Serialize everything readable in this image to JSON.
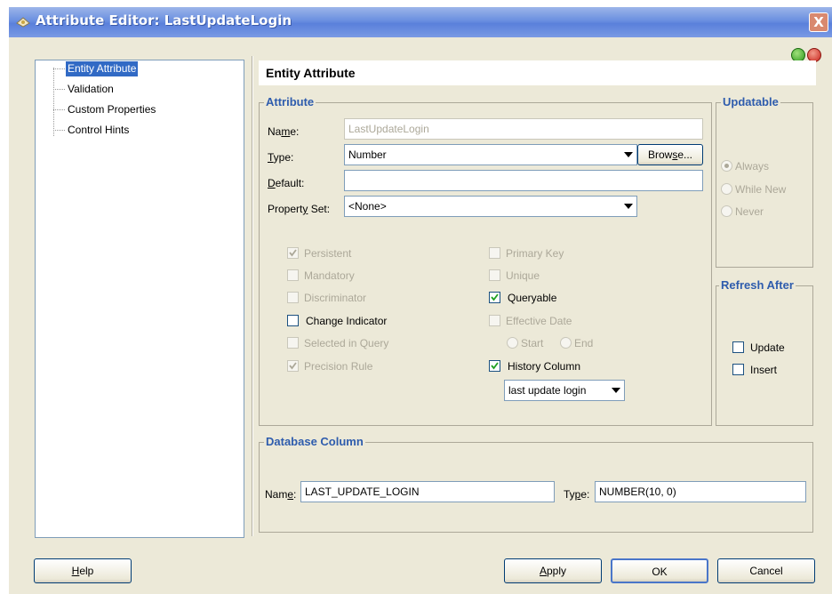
{
  "window": {
    "title": "Attribute Editor: LastUpdateLogin",
    "close_label": "X"
  },
  "tree": {
    "items": [
      {
        "label": "Entity Attribute",
        "selected": true
      },
      {
        "label": "Validation"
      },
      {
        "label": "Custom Properties"
      },
      {
        "label": "Control Hints"
      }
    ]
  },
  "panel": {
    "title": "Entity Attribute"
  },
  "attribute": {
    "group_title": "Attribute",
    "name_label": "Name:",
    "name_value": "LastUpdateLogin",
    "type_label": "Type:",
    "type_value": "Number",
    "browse_label": "Browse...",
    "default_label": "Default:",
    "default_value": "",
    "property_set_label": "Property Set:",
    "property_set_value": "<None>",
    "left_checks": [
      {
        "label": "Persistent",
        "checked": true,
        "enabled": false
      },
      {
        "label": "Mandatory",
        "checked": false,
        "enabled": false
      },
      {
        "label": "Discriminator",
        "checked": false,
        "enabled": false
      },
      {
        "label": "Change Indicator",
        "checked": false,
        "enabled": true
      },
      {
        "label": "Selected in Query",
        "checked": false,
        "enabled": false
      },
      {
        "label": "Precision Rule",
        "checked": true,
        "enabled": false
      }
    ],
    "right_checks": [
      {
        "label": "Primary Key",
        "checked": false,
        "enabled": false
      },
      {
        "label": "Unique",
        "checked": false,
        "enabled": false
      },
      {
        "label": "Queryable",
        "checked": true,
        "enabled": true
      },
      {
        "label": "Effective Date",
        "checked": false,
        "enabled": false
      }
    ],
    "effective_start": "Start",
    "effective_end": "End",
    "history_column": {
      "label": "History Column",
      "checked": true
    },
    "history_type": "last update login"
  },
  "updatable": {
    "group_title": "Updatable",
    "options": [
      {
        "label": "Always",
        "selected": true
      },
      {
        "label": "While New",
        "selected": false
      },
      {
        "label": "Never",
        "selected": false
      }
    ]
  },
  "refresh_after": {
    "group_title": "Refresh After",
    "update_label": "Update",
    "insert_label": "Insert"
  },
  "database_column": {
    "group_title": "Database Column",
    "name_label": "Name:",
    "name_value": "LAST_UPDATE_LOGIN",
    "type_label": "Type:",
    "type_value": "NUMBER(10, 0)"
  },
  "buttons": {
    "help": "Help",
    "apply": "Apply",
    "ok": "OK",
    "cancel": "Cancel"
  },
  "colors": {
    "accent": "#2e5cad",
    "selection": "#316ac5",
    "titlebar": "#6a8fe0"
  }
}
